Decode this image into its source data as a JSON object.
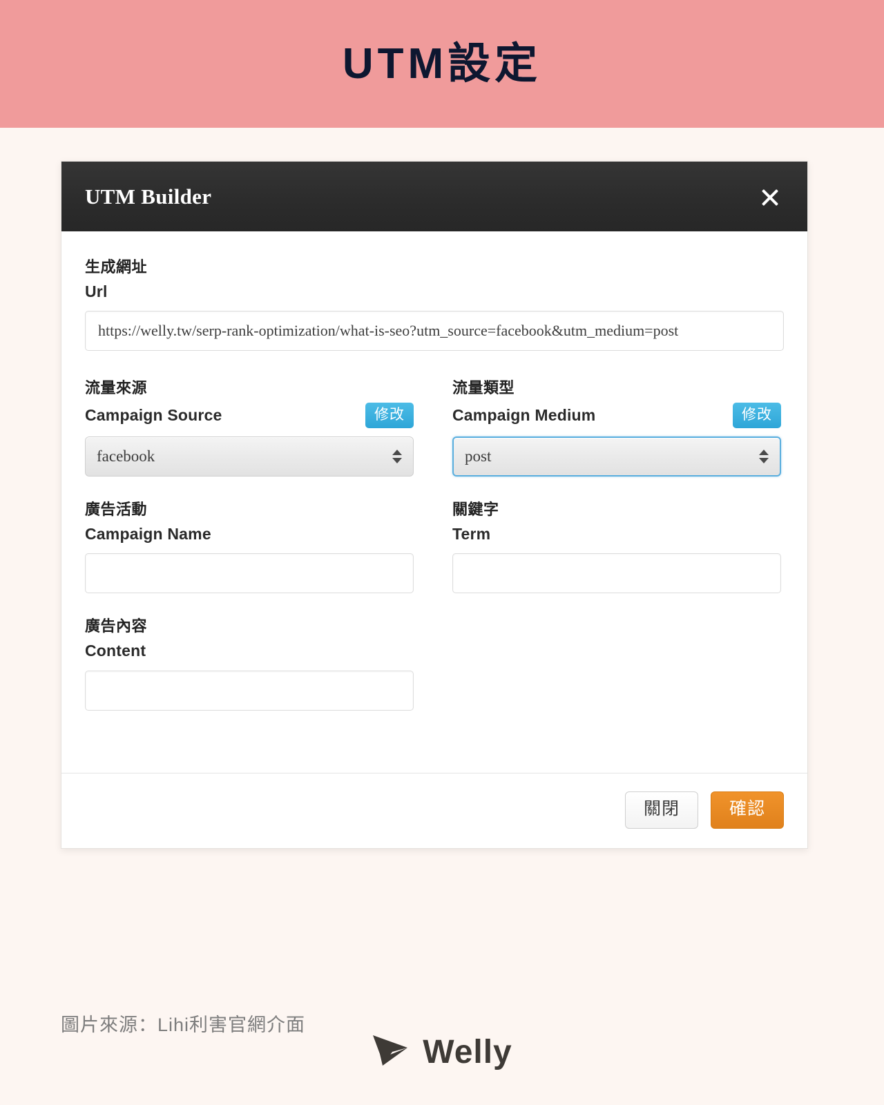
{
  "banner": {
    "title": "UTM設定",
    "bg_color": "#f09b9b",
    "text_color": "#0d1730"
  },
  "modal": {
    "title": "UTM Builder",
    "close_icon": "close-icon",
    "url_section": {
      "label_cjk": "生成網址",
      "label_en": "Url",
      "value": "https://welly.tw/serp-rank-optimization/what-is-seo?utm_source=facebook&utm_medium=post"
    },
    "fields": [
      {
        "label_cjk": "流量來源",
        "label_en": "Campaign Source",
        "edit_label": "修改",
        "type": "select",
        "value": "facebook",
        "focused": false
      },
      {
        "label_cjk": "流量類型",
        "label_en": "Campaign Medium",
        "edit_label": "修改",
        "type": "select",
        "value": "post",
        "focused": true
      },
      {
        "label_cjk": "廣告活動",
        "label_en": "Campaign Name",
        "type": "text",
        "value": "",
        "placeholder": ""
      },
      {
        "label_cjk": "關鍵字",
        "label_en": "Term",
        "type": "text",
        "value": "",
        "placeholder": ""
      },
      {
        "label_cjk": "廣告內容",
        "label_en": "Content",
        "type": "text",
        "value": "",
        "placeholder": ""
      }
    ],
    "footer": {
      "close_label": "關閉",
      "confirm_label": "確認",
      "confirm_color": "#e8881f",
      "edit_color": "#3eb0dd"
    }
  },
  "caption": "圖片來源：Lihi利害官網介面",
  "logo": {
    "text": "Welly",
    "icon": "paper-plane-icon",
    "color": "#3e3a36"
  }
}
